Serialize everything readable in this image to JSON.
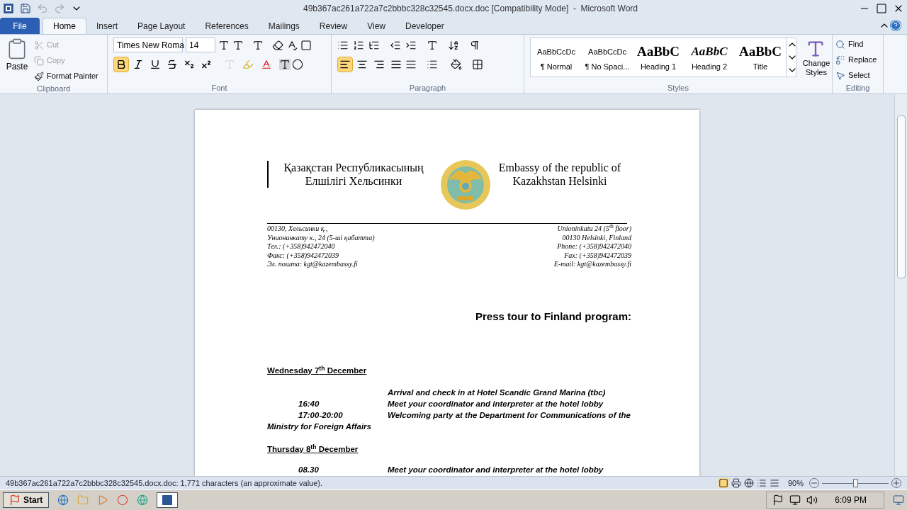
{
  "window": {
    "title": "49b367ac261a722a7c2bbbc328c32545.docx.doc [Compatibility Mode]  -  Microsoft Word"
  },
  "tabs": [
    {
      "label": "File",
      "kind": "file",
      "selected": false
    },
    {
      "label": "Home",
      "kind": "tab",
      "selected": true
    },
    {
      "label": "Insert",
      "kind": "tab",
      "selected": false
    },
    {
      "label": "Page Layout",
      "kind": "tab",
      "selected": false
    },
    {
      "label": "References",
      "kind": "tab",
      "selected": false
    },
    {
      "label": "Mailings",
      "kind": "tab",
      "selected": false
    },
    {
      "label": "Review",
      "kind": "tab",
      "selected": false
    },
    {
      "label": "View",
      "kind": "tab",
      "selected": false
    },
    {
      "label": "Developer",
      "kind": "tab",
      "selected": false
    }
  ],
  "clipboard": {
    "label": "Clipboard",
    "paste": "Paste",
    "items": [
      {
        "label": "Cut",
        "kind": "cut",
        "disabled": true
      },
      {
        "label": "Copy",
        "kind": "copy",
        "disabled": true
      },
      {
        "label": "Format Painter",
        "kind": "painter",
        "disabled": false
      }
    ]
  },
  "font": {
    "label": "Font",
    "font_name": "Times New Roma",
    "font_size": "14",
    "format_buttons": [
      {
        "kind": "bold",
        "selected": true
      },
      {
        "kind": "italic",
        "selected": false
      },
      {
        "kind": "underline",
        "selected": false
      },
      {
        "kind": "strike",
        "selected": false
      },
      {
        "kind": "subscript",
        "selected": false
      },
      {
        "kind": "superscript",
        "selected": false
      }
    ]
  },
  "paragraph": {
    "label": "Paragraph",
    "align_buttons": [
      {
        "kind": "left",
        "selected": true
      },
      {
        "kind": "center",
        "selected": false
      },
      {
        "kind": "right",
        "selected": false
      },
      {
        "kind": "justify",
        "selected": false
      }
    ]
  },
  "styles": {
    "label": "Styles",
    "items": [
      {
        "sample": "AaBbCcDc",
        "label": "¶ Normal",
        "kind": "plain"
      },
      {
        "sample": "AaBbCcDc",
        "label": "¶ No Spaci...",
        "kind": "plain"
      },
      {
        "sample": "AaBbC",
        "label": "Heading 1",
        "kind": "bold"
      },
      {
        "sample": "AaBbC",
        "label": "Heading 2",
        "kind": "italic"
      },
      {
        "sample": "AaBbC",
        "label": "Title",
        "kind": "bold"
      }
    ],
    "change_styles": "Change Styles"
  },
  "editing": {
    "label": "Editing",
    "items": [
      {
        "label": "Find",
        "kind": "find"
      },
      {
        "label": "Replace",
        "kind": "replace"
      },
      {
        "label": "Select",
        "kind": "select"
      }
    ]
  },
  "document": {
    "header_left": [
      "Қазақстан Республикасының",
      "Елшілігі Хельсинки"
    ],
    "header_right": [
      "Embassy of the republic of",
      "Kazakhstan Helsinki"
    ],
    "address_left": [
      "00130, Хельсинки қ.,",
      "Унионинкату к., 24 (5-ші қабатта)",
      "Тел.: (+358)942472040",
      "Факс: (+358)942472039",
      "Эл. пошта: kgt@kazembassy.fi"
    ],
    "address_right": [
      "Unioninkatu 24 (5$^{th}$ floor)",
      "00130 Helsinki, Finland",
      "Phone: (+358)942472040",
      "Fax: (+358)942472039",
      "E-mail: kgt@kazembassy.fi"
    ],
    "title": "Press tour to Finland program:",
    "days": [
      {
        "heading": "Wednesday 7$^{th}$ December",
        "entries": [
          {
            "text": "Arrival and check in at Hotel Scandic Grand Marina (tbc)"
          },
          {
            "time": "16:40",
            "text": "Meet  your coordinator and interpreter at the hotel lobby"
          },
          {
            "time": "17:00-20:00",
            "text": "Welcoming  party at the Department for Communications of the",
            "continuation": "Ministry for Foreign Affairs"
          }
        ]
      },
      {
        "heading": "Thursday 8$^{th}$ December",
        "entries": [
          {
            "time": "08.30",
            "text": "Meet  your coordinator and interpreter at the hotel lobby"
          }
        ]
      }
    ]
  },
  "status_bar": {
    "text": "49b367ac261a722a7c2bbbc328c32545.docx.doc: 1,771 characters (an approximate value).",
    "zoom": "90%",
    "level": 0.5
  },
  "taskbar": {
    "start": "Start",
    "time": "6:09 PM"
  }
}
